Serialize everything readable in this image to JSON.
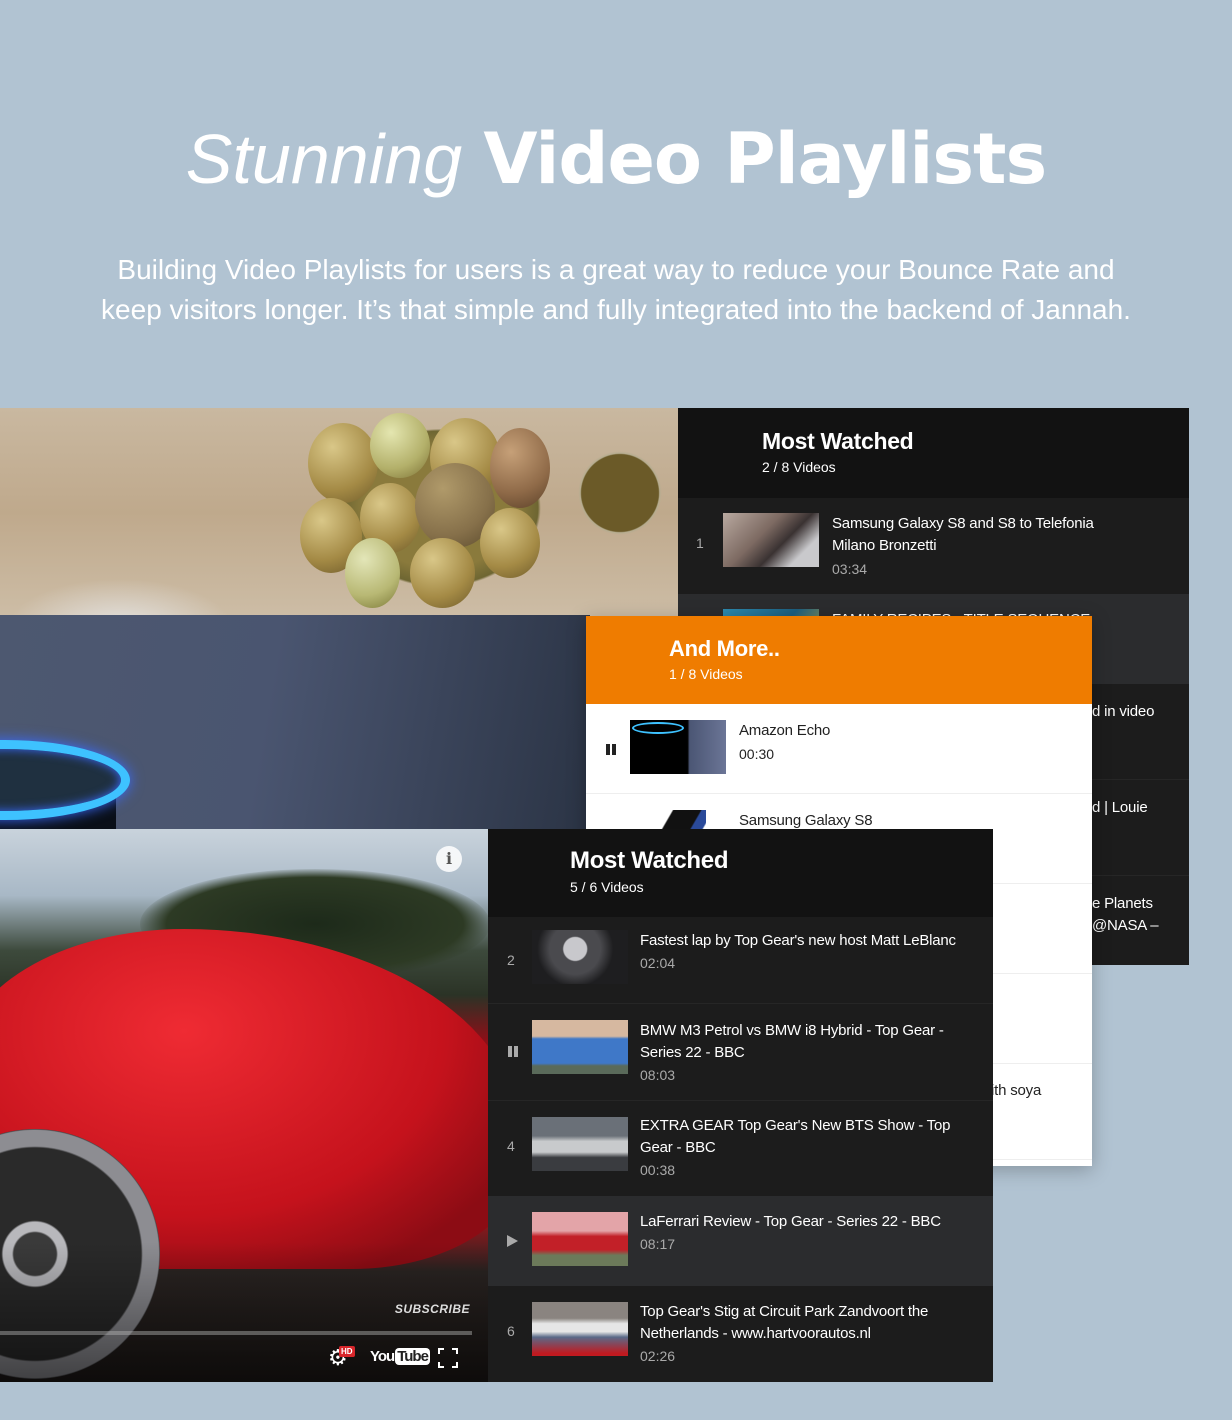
{
  "hero": {
    "title_light": "Stunning",
    "title_bold": "Video Playlists",
    "description_line1": "Building Video Playlists for users is a great way to reduce your Bounce Rate and",
    "description_line2": "keep visitors longer. It’s that simple and fully integrated into the backend of Jannah."
  },
  "colors": {
    "background": "#b1c3d2",
    "dark_panel": "#1c1c1c",
    "dark_header": "#121212",
    "active_row": "#2b2c2e",
    "orange_accent": "#ef7c00",
    "light_panel": "#ffffff"
  },
  "playlist_back": {
    "title": "Most Watched",
    "count": "2 / 8 Videos",
    "items": [
      {
        "index": "1",
        "title_line1": "Samsung Galaxy S8 and S8 to Telefonia",
        "title_line2": "Milano Bronzetti",
        "duration": "03:34",
        "thumb": "thumb-car-window"
      },
      {
        "index": "",
        "title_line1": "FAMILY RECIPES - TITLE SEQUENCE",
        "title_line2": "",
        "duration": "",
        "thumb": "thumb-recipes",
        "state": "playing"
      }
    ],
    "clipped_texts": [
      "d in video",
      "d | Louie",
      "e Planets",
      "@NASA –"
    ]
  },
  "playlist_middle": {
    "title": "And More..",
    "count": "1 / 8 Videos",
    "items": [
      {
        "index": "",
        "state": "paused",
        "title": "Amazon Echo",
        "duration": "00:30",
        "thumb": "thumb-amazon-echo"
      },
      {
        "index": "",
        "title": "Samsung Galaxy S8",
        "duration": "",
        "thumb": "thumb-galaxy-s8"
      }
    ],
    "clipped_texts": [
      "ith soya"
    ]
  },
  "playlist_front": {
    "title": "Most Watched",
    "count": "5 / 6 Videos",
    "items": [
      {
        "index": "2",
        "state": "",
        "title_line1": "Fastest lap by Top Gear's new host Matt LeBlanc",
        "title_line2": "",
        "duration": "02:04",
        "thumb": "thumb-driver"
      },
      {
        "index": "",
        "state": "paused",
        "title_line1": "BMW M3 Petrol vs BMW i8 Hybrid - Top Gear -",
        "title_line2": "Series 22 - BBC",
        "duration": "08:03",
        "thumb": "thumb-bmw"
      },
      {
        "index": "4",
        "state": "",
        "title_line1": "EXTRA GEAR Top Gear's New BTS Show - Top",
        "title_line2": "Gear - BBC",
        "duration": "00:38",
        "thumb": "thumb-silver-car"
      },
      {
        "index": "",
        "state": "playing",
        "title_line1": "LaFerrari Review - Top Gear - Series 22 - BBC",
        "title_line2": "",
        "duration": "08:17",
        "thumb": "thumb-laferrari"
      },
      {
        "index": "6",
        "state": "",
        "title_line1": "Top Gear's Stig at Circuit Park Zandvoort the",
        "title_line2": "Netherlands - www.hartvoorautos.nl",
        "duration": "02:26",
        "thumb": "thumb-stig"
      }
    ]
  },
  "player": {
    "subscribe_label": "SUBSCRIBE",
    "info_icon": "i",
    "hd_badge": "HD",
    "youtube_you": "You",
    "youtube_tube": "Tube",
    "progress_fraction": 0
  }
}
